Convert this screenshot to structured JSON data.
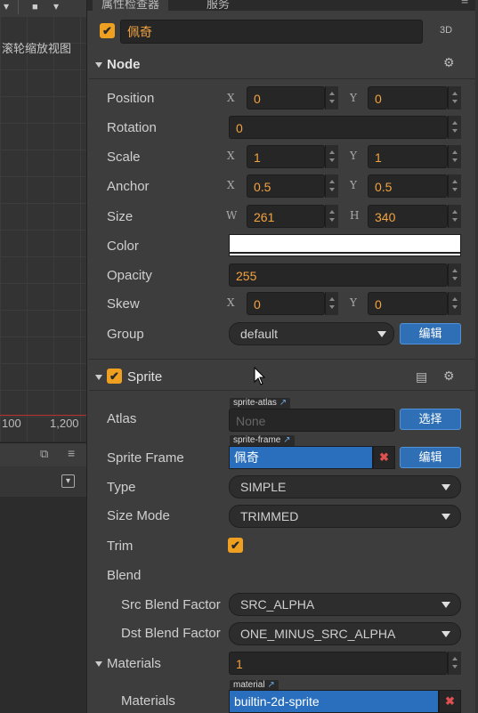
{
  "scene": {
    "toolbar_arrow": "▾",
    "camera_icon": "■",
    "scroll_hint": "滚轮缩放视图",
    "ticks": [
      "100",
      "1,200"
    ],
    "panel2_icons": [
      "⧉",
      "≡"
    ],
    "filter_icon": "▾"
  },
  "inspector": {
    "tabs": {
      "inspector": "属性检查器",
      "service": "服务"
    },
    "node_name": "佩奇",
    "mode_3d": "3D",
    "node_section": {
      "title": "Node",
      "position": {
        "label": "Position",
        "x": "0",
        "y": "0"
      },
      "rotation": {
        "label": "Rotation",
        "value": "0"
      },
      "scale": {
        "label": "Scale",
        "x": "1",
        "y": "1"
      },
      "anchor": {
        "label": "Anchor",
        "x": "0.5",
        "y": "0.5"
      },
      "size": {
        "label": "Size",
        "w": "261",
        "h": "340"
      },
      "color": {
        "label": "Color",
        "value": "#ffffff"
      },
      "opacity": {
        "label": "Opacity",
        "value": "255"
      },
      "skew": {
        "label": "Skew",
        "x": "0",
        "y": "0"
      },
      "group": {
        "label": "Group",
        "value": "default",
        "edit_button": "编辑"
      },
      "axis_labels": {
        "x": "X",
        "y": "Y",
        "w": "W",
        "h": "H"
      }
    },
    "sprite_section": {
      "title": "Sprite",
      "atlas": {
        "label": "Atlas",
        "tag": "sprite-atlas",
        "value": "None",
        "button": "选择"
      },
      "sprite_frame": {
        "label": "Sprite Frame",
        "tag": "sprite-frame",
        "value": "佩奇",
        "button": "编辑"
      },
      "type": {
        "label": "Type",
        "value": "SIMPLE"
      },
      "size_mode": {
        "label": "Size Mode",
        "value": "TRIMMED"
      },
      "trim": {
        "label": "Trim",
        "checked": true
      },
      "blend": {
        "label": "Blend"
      },
      "src_blend": {
        "label": "Src Blend Factor",
        "value": "SRC_ALPHA"
      },
      "dst_blend": {
        "label": "Dst Blend Factor",
        "value": "ONE_MINUS_SRC_ALPHA"
      },
      "materials_group": {
        "label": "Materials",
        "count": "1"
      },
      "materials": {
        "label": "Materials",
        "tag": "material",
        "value": "builtin-2d-sprite"
      }
    },
    "icons": {
      "gear": "⚙",
      "book": "▤",
      "check": "✔",
      "close": "✖",
      "link": "↗"
    }
  }
}
